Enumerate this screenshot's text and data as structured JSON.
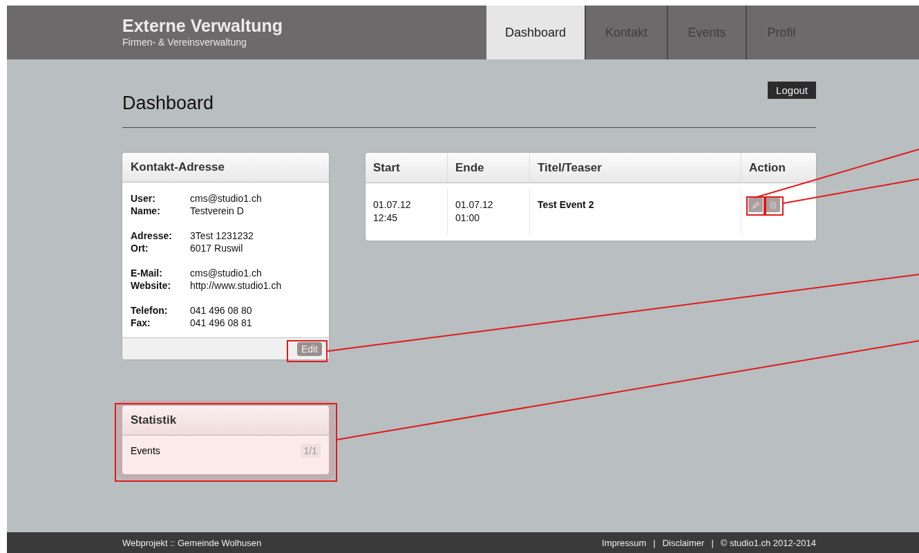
{
  "header": {
    "title": "Externe Verwaltung",
    "subtitle": "Firmen- & Vereinsverwaltung"
  },
  "nav": [
    {
      "label": "Dashboard",
      "selected": true
    },
    {
      "label": "Kontakt",
      "selected": false
    },
    {
      "label": "Events",
      "selected": false
    },
    {
      "label": "Profil",
      "selected": false
    }
  ],
  "page_title": "Dashboard",
  "logout_button": "Logout",
  "contact_panel": {
    "title": "Kontakt-Adresse",
    "groups": [
      [
        {
          "label": "User:",
          "value": "cms@studio1.ch"
        },
        {
          "label": "Name:",
          "value": "Testverein D"
        }
      ],
      [
        {
          "label": "Adresse:",
          "value": "3Test 1231232"
        },
        {
          "label": "Ort:",
          "value": "6017 Ruswil"
        }
      ],
      [
        {
          "label": "E-Mail:",
          "value": "cms@studio1.ch"
        },
        {
          "label": "Website:",
          "value": "http://www.studio1.ch"
        }
      ],
      [
        {
          "label": "Telefon:",
          "value": "041 496 08 80"
        },
        {
          "label": "Fax:",
          "value": "041 496 08 81"
        }
      ]
    ],
    "edit_button": "Edit"
  },
  "events_table": {
    "columns": [
      "Start",
      "Ende",
      "Titel/Teaser",
      "Action"
    ],
    "rows": [
      {
        "start": [
          "01.07.12",
          "12:45"
        ],
        "end": [
          "01.07.12",
          "01:00"
        ],
        "title": "Test Event 2"
      }
    ]
  },
  "stats_panel": {
    "title": "Statistik",
    "highlighted": true,
    "items": [
      {
        "label": "Events",
        "count": "1/1"
      }
    ]
  },
  "footer": {
    "left": "Webprojekt :: Gemeinde Wolhusen",
    "links": [
      "Impressum",
      "Disclaimer"
    ],
    "separator": "|",
    "copyright": "© studio1.ch 2012-2014"
  }
}
